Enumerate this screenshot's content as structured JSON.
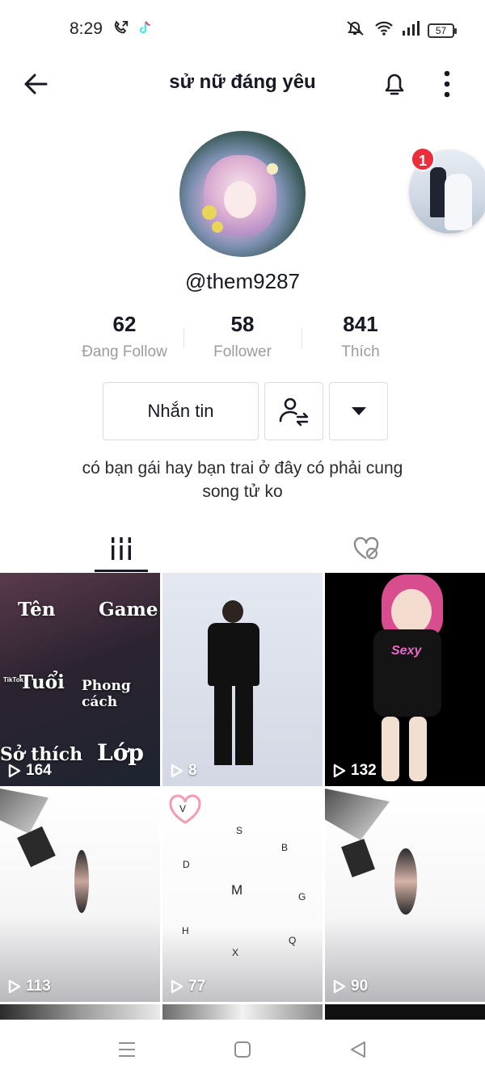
{
  "status_bar": {
    "time": "8:29",
    "battery": "57"
  },
  "header": {
    "title": "sử nữ đáng yêu"
  },
  "profile": {
    "username": "@them9287",
    "notification_count": "1",
    "stats": [
      {
        "value": "62",
        "label": "Đang Follow"
      },
      {
        "value": "58",
        "label": "Follower"
      },
      {
        "value": "841",
        "label": "Thích"
      }
    ],
    "message_button": "Nhắn tin",
    "bio": "có bạn gái hay bạn trai ở đây có phải cung song tử ko"
  },
  "videos": [
    {
      "views": "164",
      "overlay": {
        "ten": "Tên",
        "game": "Game",
        "tuoi": "Tuổi",
        "phong_cach": "Phong cách",
        "so_thich": "Sở thích",
        "lop": "Lớp",
        "brand": "TikTok"
      }
    },
    {
      "views": "8"
    },
    {
      "views": "132",
      "shirt_text": "Sexy"
    },
    {
      "views": "113"
    },
    {
      "views": "77",
      "letters": [
        "V",
        "S",
        "B",
        "D",
        "M",
        "G",
        "H",
        "Q",
        "X"
      ]
    },
    {
      "views": "90"
    }
  ],
  "colors": {
    "accent_red": "#ea2e3b",
    "text_primary": "#161823",
    "text_secondary": "#9b9ba2"
  }
}
